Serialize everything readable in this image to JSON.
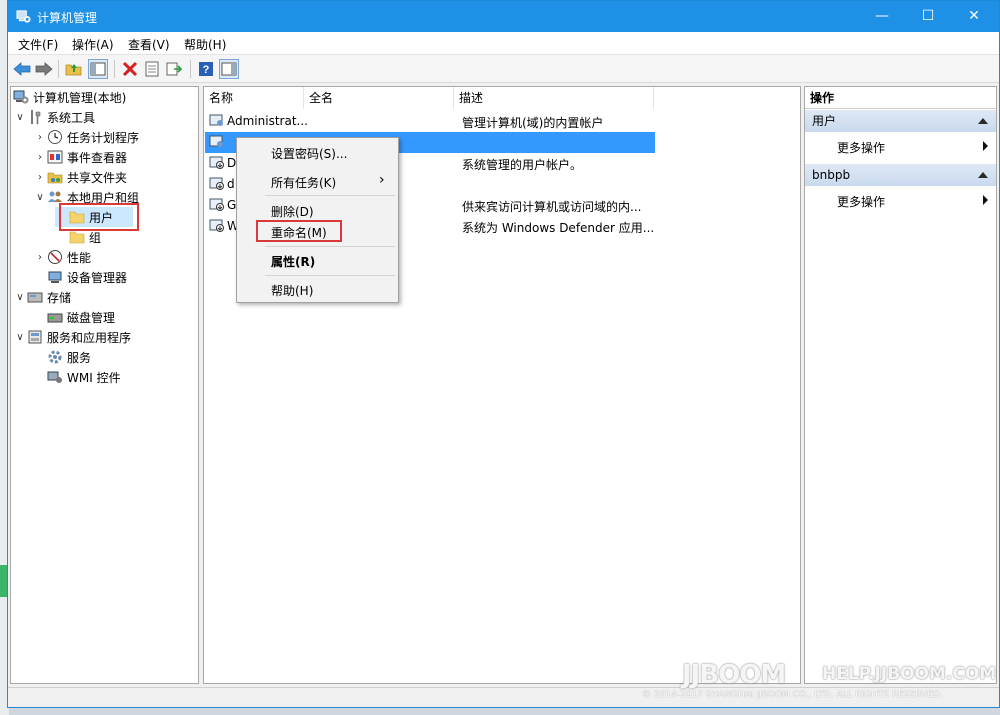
{
  "window": {
    "title": "计算机管理",
    "minimize": "—",
    "maximize": "☐",
    "close": "✕"
  },
  "menu": [
    "文件(F)",
    "操作(A)",
    "查看(V)",
    "帮助(H)"
  ],
  "tree": {
    "root": "计算机管理(本地)",
    "system_tools": "系统工具",
    "task_scheduler": "任务计划程序",
    "event_viewer": "事件查看器",
    "shared_folders": "共享文件夹",
    "local_users": "本地用户和组",
    "users": "用户",
    "groups": "组",
    "performance": "性能",
    "device_manager": "设备管理器",
    "storage": "存储",
    "disk_management": "磁盘管理",
    "services_apps": "服务和应用程序",
    "services": "服务",
    "wmi": "WMI 控件"
  },
  "columns": {
    "name": "名称",
    "fullname": "全名",
    "desc": "描述"
  },
  "rows": [
    {
      "name": "Administrat...",
      "desc": "管理计算机(域)的内置帐户"
    },
    {
      "name": "",
      "desc": ""
    },
    {
      "name": "D",
      "desc": "系统管理的用户帐户。"
    },
    {
      "name": "d",
      "desc": ""
    },
    {
      "name": "G",
      "desc": "供来宾访问计算机或访问域的内..."
    },
    {
      "name": "W",
      "desc": "系统为 Windows Defender 应用..."
    }
  ],
  "context_menu": {
    "set_password": "设置密码(S)...",
    "all_tasks": "所有任务(K)",
    "submenu_arrow": "›",
    "delete": "删除(D)",
    "rename": "重命名(M)",
    "properties": "属性(R)",
    "help": "帮助(H)"
  },
  "actions": {
    "header": "操作",
    "section1": "用户",
    "more1": "更多操作",
    "section2": "bnbpb",
    "more2": "更多操作"
  },
  "watermark": {
    "logo": "JJBOOM",
    "site": "HELP.JJBOOM.COM",
    "copyright": "© 2014-2017 SHANGHAI JJBOOM CO., LTD. ALL RIGHTS RESERVED."
  }
}
